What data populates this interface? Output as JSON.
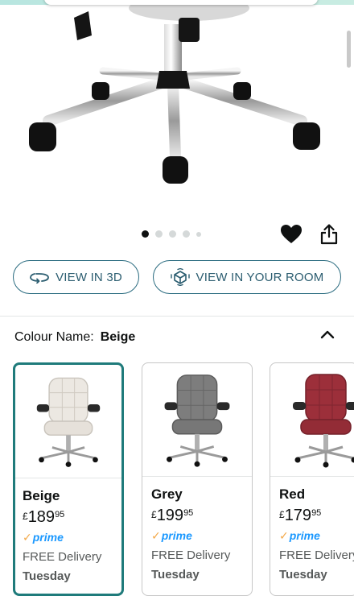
{
  "gallery": {
    "image_count": 5,
    "active_index": 0
  },
  "actions": {
    "view_3d_label": "VIEW IN 3D",
    "view_room_label": "VIEW IN YOUR ROOM"
  },
  "colour": {
    "label": "Colour Name:",
    "selected": "Beige",
    "options": [
      {
        "name": "Beige",
        "currency": "£",
        "whole": "189",
        "fraction": "95",
        "prime": "prime",
        "delivery": "FREE Delivery",
        "day": "Tuesday",
        "color": "#ece8e2"
      },
      {
        "name": "Grey",
        "currency": "£",
        "whole": "199",
        "fraction": "95",
        "prime": "prime",
        "delivery": "FREE Delivery",
        "day": "Tuesday",
        "color": "#7d7d7d"
      },
      {
        "name": "Red",
        "currency": "£",
        "whole": "179",
        "fraction": "95",
        "prime": "prime",
        "delivery": "FREE Delivery",
        "day": "Tuesday",
        "color": "#9c2f3a"
      }
    ]
  },
  "colors": {
    "accent": "#1f7b7b",
    "button_text": "#2b5d70",
    "prime_blue": "#1a98ff",
    "prime_check": "#f3a847"
  }
}
